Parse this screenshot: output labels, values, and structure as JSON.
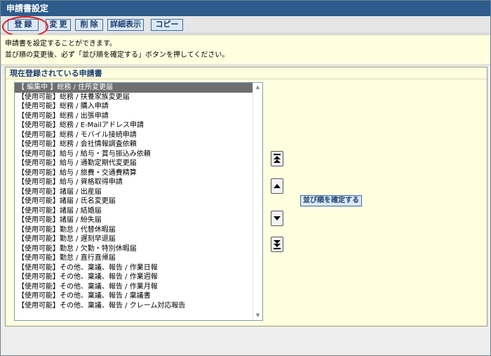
{
  "window": {
    "title": "申請書設定"
  },
  "toolbar": {
    "register_label": "登 録",
    "change_label": "変 更",
    "delete_label": "削 除",
    "details_label": "詳細表示",
    "copy_label": "コピー"
  },
  "info": {
    "line1": "申請書を設定することができます。",
    "line2": "並び順の変更後、必ず「並び順を確定する」ボタンを押してください。"
  },
  "panel": {
    "title": "現在登録されている申請書",
    "confirm_label": "並び順を確定する"
  },
  "list": {
    "items": [
      "【 編集中 】総務 / 住所変更届",
      "【使用可能】総務 / 扶養家族変更届",
      "【使用可能】総務 / 購入申請",
      "【使用可能】総務 / 出張申請",
      "【使用可能】総務 / E-Mailアドレス申請",
      "【使用可能】総務 / モバイル接続申請",
      "【使用可能】総務 / 会社情報調査依頼",
      "【使用可能】給与 / 給与・賞与振込み依頼",
      "【使用可能】給与 / 通勤定期代変更届",
      "【使用可能】給与 / 旅費・交通費精算",
      "【使用可能】給与 / 資格取得申請",
      "【使用可能】諸届 / 出産届",
      "【使用可能】諸届 / 氏名変更届",
      "【使用可能】諸届 / 結婚届",
      "【使用可能】諸届 / 紛失届",
      "【使用可能】勤怠 / 代替休暇届",
      "【使用可能】勤怠 / 遅刻早退届",
      "【使用可能】勤怠 / 欠勤・特別休暇届",
      "【使用可能】勤怠 / 直行直帰届",
      "【使用可能】その他、稟議、報告 / 作業日報",
      "【使用可能】その他、稟議、報告 / 作業週報",
      "【使用可能】その他、稟議、報告 / 作業月報",
      "【使用可能】その他、稟議、報告 / 稟議書",
      "【使用可能】その他、稟議、報告 / クレーム対応報告"
    ],
    "selected_index": 0
  },
  "order_buttons": [
    "move-top-icon",
    "move-up-icon",
    "move-down-icon",
    "move-bottom-icon"
  ],
  "colors": {
    "titlebar": "#2d5b8c",
    "button_border": "#3a6aa8",
    "info_bg": "#ffffe0",
    "highlight": "#e01b1b"
  }
}
